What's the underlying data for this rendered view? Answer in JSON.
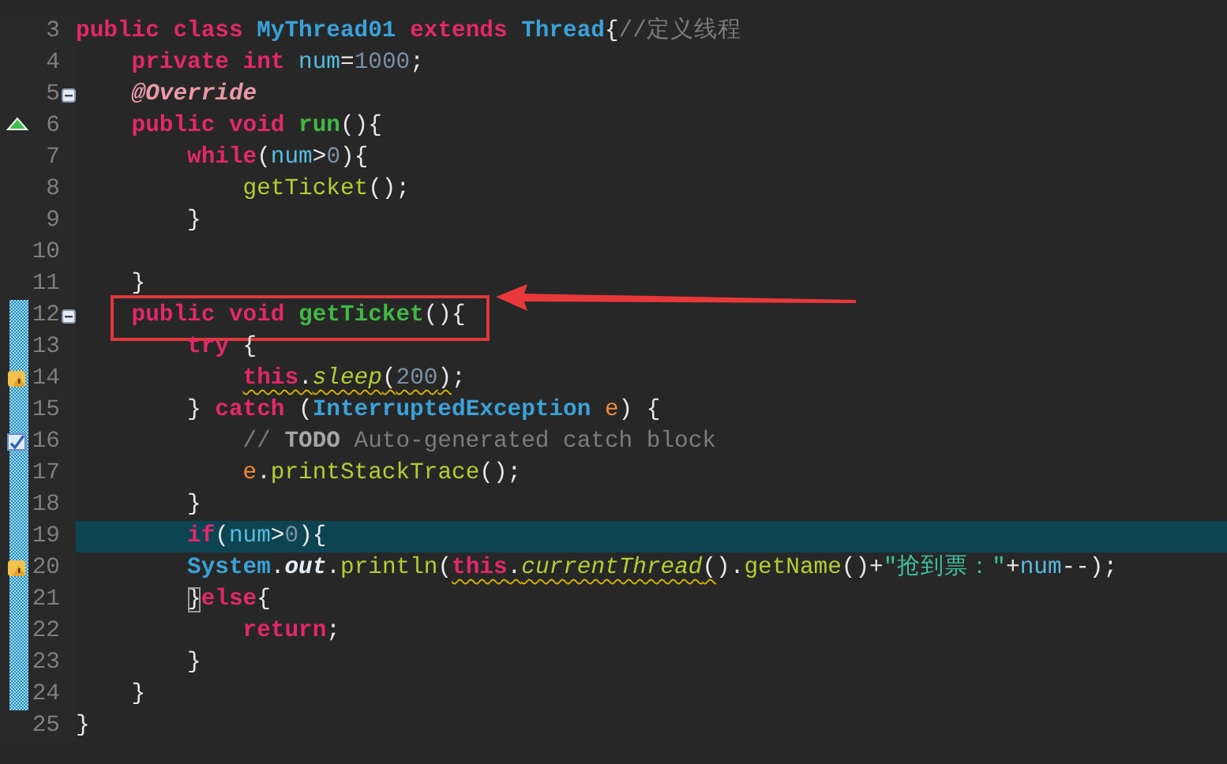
{
  "editor": {
    "lines": [
      {
        "n": "3",
        "kind": "plain",
        "changed": false,
        "current": false,
        "foldable": false,
        "boxed": false,
        "tokens": [
          {
            "kind": "keyword",
            "text": "public class "
          },
          {
            "kind": "type",
            "text": "MyThread01 "
          },
          {
            "kind": "keyword",
            "text": "extends "
          },
          {
            "kind": "type",
            "text": "Thread"
          },
          {
            "kind": "plain",
            "text": "{"
          },
          {
            "kind": "comment",
            "text": "//定义线程"
          }
        ]
      },
      {
        "n": "4",
        "kind": "plain",
        "changed": false,
        "current": false,
        "foldable": false,
        "boxed": false,
        "tokens": [
          {
            "kind": "keyword",
            "text": "    private int "
          },
          {
            "kind": "field",
            "text": "num"
          },
          {
            "kind": "plain",
            "text": "="
          },
          {
            "kind": "number",
            "text": "1000"
          },
          {
            "kind": "plain",
            "text": ";"
          }
        ]
      },
      {
        "n": "5",
        "kind": "plain",
        "changed": false,
        "current": false,
        "foldable": true,
        "boxed": false,
        "tokens": [
          {
            "kind": "annotation",
            "text": "    @Override"
          }
        ]
      },
      {
        "n": "6",
        "kind": "override",
        "changed": false,
        "current": false,
        "foldable": false,
        "boxed": false,
        "tokens": [
          {
            "kind": "keyword",
            "text": "    public void "
          },
          {
            "kind": "method-decl",
            "text": "run"
          },
          {
            "kind": "plain",
            "text": "(){"
          }
        ]
      },
      {
        "n": "7",
        "kind": "plain",
        "changed": false,
        "current": false,
        "foldable": false,
        "boxed": false,
        "tokens": [
          {
            "kind": "keyword",
            "text": "        while"
          },
          {
            "kind": "plain",
            "text": "("
          },
          {
            "kind": "field",
            "text": "num"
          },
          {
            "kind": "plain",
            "text": ">"
          },
          {
            "kind": "number",
            "text": "0"
          },
          {
            "kind": "plain",
            "text": "){"
          }
        ]
      },
      {
        "n": "8",
        "kind": "plain",
        "changed": false,
        "current": false,
        "foldable": false,
        "boxed": false,
        "tokens": [
          {
            "kind": "call",
            "text": "            getTicket"
          },
          {
            "kind": "plain",
            "text": "();"
          }
        ]
      },
      {
        "n": "9",
        "kind": "plain",
        "changed": false,
        "current": false,
        "foldable": false,
        "boxed": false,
        "tokens": [
          {
            "kind": "plain",
            "text": "        }"
          }
        ]
      },
      {
        "n": "10",
        "kind": "plain",
        "changed": false,
        "current": false,
        "foldable": false,
        "boxed": false
      },
      {
        "n": "11",
        "kind": "plain",
        "changed": false,
        "current": false,
        "foldable": false,
        "boxed": false,
        "tokens": [
          {
            "kind": "plain",
            "text": "    }"
          }
        ]
      },
      {
        "n": "12",
        "kind": "plain",
        "changed": true,
        "current": false,
        "foldable": true,
        "boxed": true,
        "tokens": [
          {
            "kind": "keyword",
            "text": "    public void "
          },
          {
            "kind": "method-decl",
            "text": "getTicket"
          },
          {
            "kind": "plain",
            "text": "(){"
          }
        ]
      },
      {
        "n": "13",
        "kind": "plain",
        "changed": true,
        "current": false,
        "foldable": false,
        "boxed": false,
        "tokens": [
          {
            "kind": "keyword",
            "text": "        try"
          },
          {
            "kind": "plain",
            "text": " {"
          }
        ]
      },
      {
        "n": "14",
        "kind": "warning",
        "changed": true,
        "current": false,
        "foldable": false,
        "boxed": false,
        "tokens": [
          {
            "kind": "keyword",
            "text": "            this",
            "warn": true
          },
          {
            "kind": "plain",
            "text": ".",
            "warn": true
          },
          {
            "kind": "static-call",
            "text": "sleep",
            "warn": true
          },
          {
            "kind": "plain",
            "text": "(",
            "warn": true
          },
          {
            "kind": "number",
            "text": "200",
            "warn": true
          },
          {
            "kind": "plain",
            "text": ")",
            "warn": true
          },
          {
            "kind": "plain",
            "text": ";"
          }
        ]
      },
      {
        "n": "15",
        "kind": "plain",
        "changed": true,
        "current": false,
        "foldable": false,
        "boxed": false,
        "tokens": [
          {
            "kind": "plain",
            "text": "        } "
          },
          {
            "kind": "keyword",
            "text": "catch"
          },
          {
            "kind": "plain",
            "text": " ("
          },
          {
            "kind": "type",
            "text": "InterruptedException "
          },
          {
            "kind": "param",
            "text": "e"
          },
          {
            "kind": "plain",
            "text": ") {"
          }
        ]
      },
      {
        "n": "16",
        "kind": "task",
        "changed": true,
        "current": false,
        "foldable": false,
        "boxed": false,
        "tokens": [
          {
            "kind": "comment",
            "text": "            // "
          },
          {
            "kind": "todo",
            "text": "TODO"
          },
          {
            "kind": "comment",
            "text": " Auto-generated catch block"
          }
        ]
      },
      {
        "n": "17",
        "kind": "plain",
        "changed": true,
        "current": false,
        "foldable": false,
        "boxed": false,
        "tokens": [
          {
            "kind": "param",
            "text": "            e"
          },
          {
            "kind": "plain",
            "text": "."
          },
          {
            "kind": "call",
            "text": "printStackTrace"
          },
          {
            "kind": "plain",
            "text": "();"
          }
        ]
      },
      {
        "n": "18",
        "kind": "plain",
        "changed": true,
        "current": false,
        "foldable": false,
        "boxed": false,
        "tokens": [
          {
            "kind": "plain",
            "text": "        }"
          }
        ]
      },
      {
        "n": "19",
        "kind": "plain",
        "changed": true,
        "current": true,
        "foldable": false,
        "boxed": false,
        "tokens": [
          {
            "kind": "keyword",
            "text": "        if"
          },
          {
            "kind": "plain",
            "text": "("
          },
          {
            "kind": "field",
            "text": "num"
          },
          {
            "kind": "plain",
            "text": ">"
          },
          {
            "kind": "number",
            "text": "0"
          },
          {
            "kind": "plain",
            "text": "){"
          }
        ]
      },
      {
        "n": "20",
        "kind": "warning",
        "changed": true,
        "current": false,
        "foldable": false,
        "boxed": false,
        "tokens": [
          {
            "kind": "type",
            "text": "        System"
          },
          {
            "kind": "plain",
            "text": "."
          },
          {
            "kind": "static-field",
            "text": "out"
          },
          {
            "kind": "plain",
            "text": "."
          },
          {
            "kind": "call",
            "text": "println"
          },
          {
            "kind": "plain",
            "text": "("
          },
          {
            "kind": "keyword",
            "text": "this",
            "warn": true
          },
          {
            "kind": "plain",
            "text": ".",
            "warn": true
          },
          {
            "kind": "static-call",
            "text": "currentThread",
            "warn": true
          },
          {
            "kind": "plain",
            "text": "(",
            "warn": true
          },
          {
            "kind": "plain",
            "text": ")."
          },
          {
            "kind": "call",
            "text": "getName"
          },
          {
            "kind": "plain",
            "text": "()+"
          },
          {
            "kind": "string",
            "text": "\"抢到票：\""
          },
          {
            "kind": "plain",
            "text": "+"
          },
          {
            "kind": "field",
            "text": "num"
          },
          {
            "kind": "plain",
            "text": "--);"
          }
        ]
      },
      {
        "n": "21",
        "kind": "plain",
        "changed": true,
        "current": false,
        "foldable": false,
        "boxed": false,
        "tokens": [
          {
            "kind": "plain",
            "text": "        }",
            "matched": true
          },
          {
            "kind": "keyword",
            "text": "else"
          },
          {
            "kind": "plain",
            "text": "{"
          }
        ]
      },
      {
        "n": "22",
        "kind": "plain",
        "changed": true,
        "current": false,
        "foldable": false,
        "boxed": false,
        "tokens": [
          {
            "kind": "keyword",
            "text": "            return"
          },
          {
            "kind": "plain",
            "text": ";"
          }
        ]
      },
      {
        "n": "23",
        "kind": "plain",
        "changed": true,
        "current": false,
        "foldable": false,
        "boxed": false,
        "tokens": [
          {
            "kind": "plain",
            "text": "        }"
          }
        ]
      },
      {
        "n": "24",
        "kind": "plain",
        "changed": true,
        "current": false,
        "foldable": false,
        "boxed": false,
        "tokens": [
          {
            "kind": "plain",
            "text": "    }"
          }
        ]
      },
      {
        "n": "25",
        "kind": "plain",
        "changed": false,
        "current": false,
        "foldable": false,
        "boxed": false,
        "tokens": [
          {
            "kind": "plain",
            "text": "}"
          }
        ]
      }
    ]
  }
}
